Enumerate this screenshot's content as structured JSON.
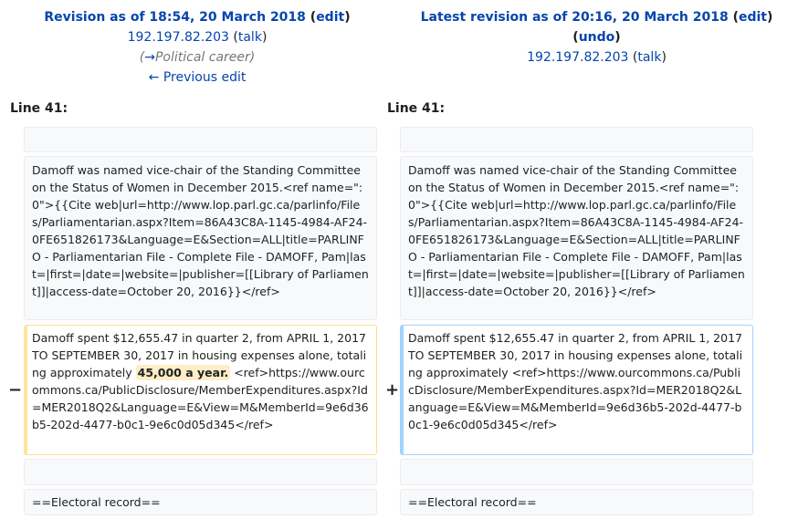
{
  "left_header": {
    "title_prefix": "Revision as of 18:54, 20 March 2018",
    "open_paren": " (",
    "edit_link": "edit",
    "close_paren": ")",
    "user": "192.197.82.203",
    "talk_link": "talk",
    "summary_arrow": "→",
    "summary_section": "Political career",
    "prev_edit_link": "← Previous edit"
  },
  "right_header": {
    "title_prefix": "Latest revision as of 20:16, 20 March 2018",
    "open_paren": " (",
    "edit_link": "edit",
    "close_paren": ")",
    "undo_link": "undo",
    "user": "192.197.82.203",
    "talk_link": "talk"
  },
  "line_label_left": "Line 41:",
  "line_label_right": "Line 41:",
  "context_paragraph": "Damoff was named vice-chair of the Standing Committee on the Status of Women in December 2015.<ref name=\":0\">{{Cite web|url=http://www.lop.parl.gc.ca/parlinfo/Files/Parliamentarian.aspx?Item=86A43C8A-1145-4984-AF24-0FE651826173&Language=E&Section=ALL|title=PARLINFO - Parliamentarian File - Complete File - DAMOFF, Pam|last=|first=|date=|website=|publisher=[[Library of Parliament]]|access-date=October 20, 2016}}</ref>",
  "deleted_line": {
    "marker": "−",
    "text_before": "Damoff spent $12,655.47 in quarter 2, from APRIL 1, 2017 TO SEPTEMBER 30, 2017 in housing expenses alone, totaling approximately ",
    "highlight": "45,000 a year.",
    "text_after": " <ref>https://www.ourcommons.ca/PublicDisclosure/MemberExpenditures.aspx?Id=MER2018Q2&Language=E&View=M&MemberId=9e6d36b5-202d-4477-b0c1-9e6c0d05d345</ref>"
  },
  "added_line": {
    "marker": "+",
    "text": "Damoff spent $12,655.47 in quarter 2, from APRIL 1, 2017 TO SEPTEMBER 30, 2017 in housing expenses alone, totaling approximately <ref>https://www.ourcommons.ca/PublicDisclosure/MemberExpenditures.aspx?Id=MER2018Q2&Language=E&View=M&MemberId=9e6d36b5-202d-4477-b0c1-9e6c0d05d345</ref>"
  },
  "section_heading": "==Electoral record=="
}
